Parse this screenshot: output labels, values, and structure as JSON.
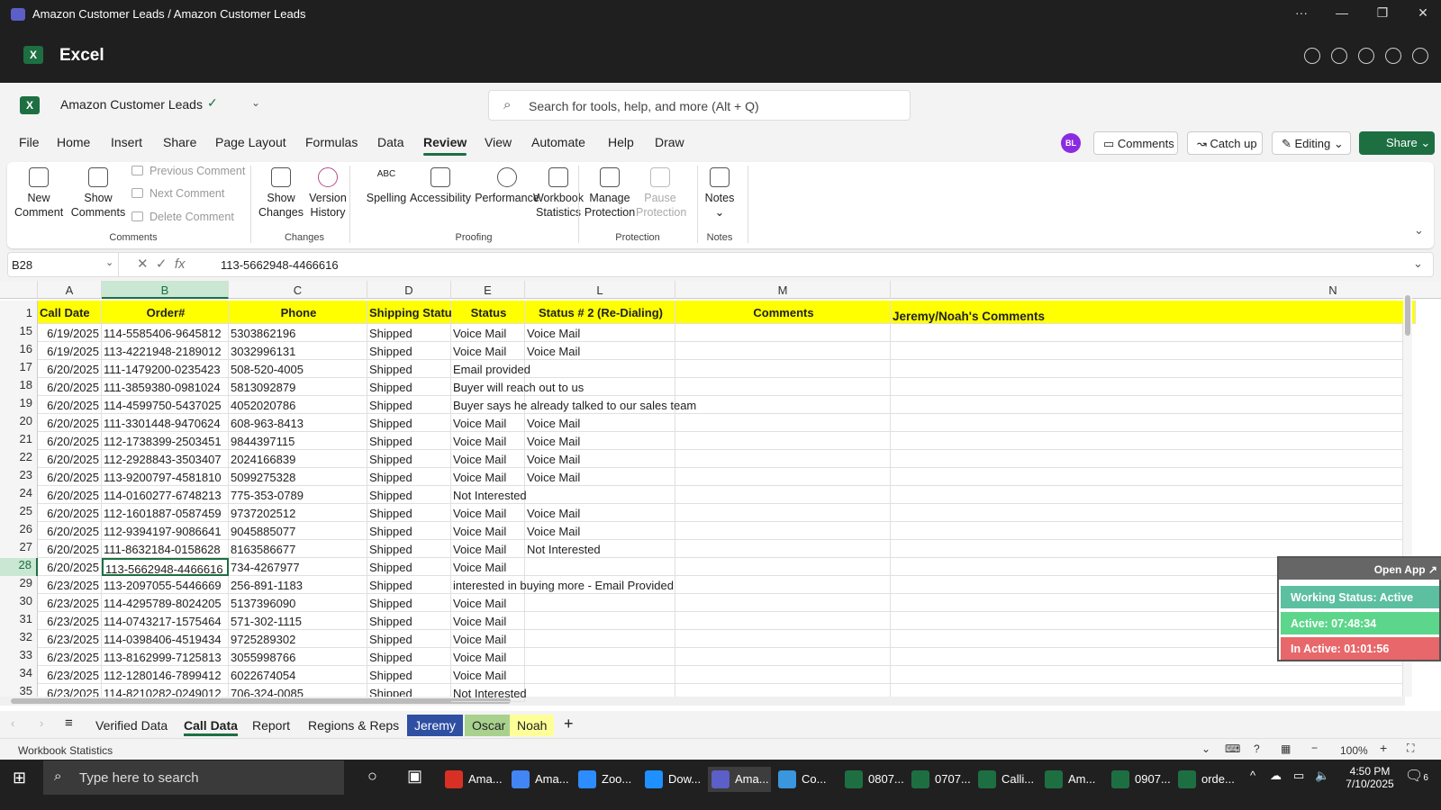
{
  "window": {
    "title": "Amazon Customer Leads / Amazon Customer Leads"
  },
  "app": {
    "name": "Excel"
  },
  "doc": {
    "name": "Amazon Customer Leads"
  },
  "search": {
    "placeholder": "Search for tools, help, and more (Alt + Q)"
  },
  "tabs": [
    "File",
    "Home",
    "Insert",
    "Share",
    "Page Layout",
    "Formulas",
    "Data",
    "Review",
    "View",
    "Automate",
    "Help",
    "Draw"
  ],
  "active_tab": "Review",
  "header": {
    "avatar": "BL",
    "comments": "Comments",
    "catchup": "Catch up",
    "editing": "Editing",
    "share": "Share"
  },
  "ribbon": {
    "new_comment": "New Comment",
    "show_comments": "Show Comments",
    "previous_comment": "Previous Comment",
    "next_comment": "Next Comment",
    "delete_comment": "Delete Comment",
    "group_comments": "Comments",
    "show_changes": "Show Changes",
    "version_history": "Version History",
    "group_changes": "Changes",
    "spelling": "Spelling",
    "accessibility": "Accessibility",
    "performance": "Performance",
    "workbook_statistics": "Workbook Statistics",
    "group_proofing": "Proofing",
    "manage_protection": "Manage Protection",
    "pause_protection": "Pause Protection",
    "group_protection": "Protection",
    "notes": "Notes",
    "group_notes": "Notes"
  },
  "formula": {
    "namebox": "B28",
    "fx": "fx",
    "value": "113-5662948-4466616"
  },
  "columns": [
    "A",
    "B",
    "C",
    "D",
    "E",
    "L",
    "M",
    "N"
  ],
  "header_row": {
    "num": "1",
    "a": "Call Date",
    "b": "Order#",
    "c": "Phone",
    "d": "Shipping Status",
    "e": "Status",
    "l": "Status # 2 (Re-Dialing)",
    "m": "Comments",
    "n": "Jeremy/Noah's Comments"
  },
  "rows": [
    {
      "num": "15",
      "a": "6/19/2025",
      "b": "114-5585406-9645812",
      "c": "5303862196",
      "d": "Shipped",
      "e": "Voice Mail",
      "l": "Voice Mail"
    },
    {
      "num": "16",
      "a": "6/19/2025",
      "b": "113-4221948-2189012",
      "c": "3032996131",
      "d": "Shipped",
      "e": "Voice Mail",
      "l": "Voice Mail"
    },
    {
      "num": "17",
      "a": "6/20/2025",
      "b": "111-1479200-0235423",
      "c": "508-520-4005",
      "d": "Shipped",
      "e": "Email provided",
      "l": ""
    },
    {
      "num": "18",
      "a": "6/20/2025",
      "b": "111-3859380-0981024",
      "c": "5813092879",
      "d": "Shipped",
      "e": "Buyer will reach out to us",
      "l": ""
    },
    {
      "num": "19",
      "a": "6/20/2025",
      "b": "114-4599750-5437025",
      "c": "4052020786",
      "d": "Shipped",
      "e": "Buyer says he already talked to our sales team",
      "l": ""
    },
    {
      "num": "20",
      "a": "6/20/2025",
      "b": "111-3301448-9470624",
      "c": "608-963-8413",
      "d": "Shipped",
      "e": "Voice Mail",
      "l": "Voice Mail"
    },
    {
      "num": "21",
      "a": "6/20/2025",
      "b": "112-1738399-2503451",
      "c": "9844397115",
      "d": "Shipped",
      "e": "Voice Mail",
      "l": "Voice Mail"
    },
    {
      "num": "22",
      "a": "6/20/2025",
      "b": "112-2928843-3503407",
      "c": "2024166839",
      "d": "Shipped",
      "e": "Voice Mail",
      "l": "Voice Mail"
    },
    {
      "num": "23",
      "a": "6/20/2025",
      "b": "113-9200797-4581810",
      "c": "5099275328",
      "d": "Shipped",
      "e": "Voice Mail",
      "l": "Voice Mail"
    },
    {
      "num": "24",
      "a": "6/20/2025",
      "b": "114-0160277-6748213",
      "c": "775-353-0789",
      "d": "Shipped",
      "e": "Not Interested",
      "l": ""
    },
    {
      "num": "25",
      "a": "6/20/2025",
      "b": "112-1601887-0587459",
      "c": "9737202512",
      "d": "Shipped",
      "e": "Voice Mail",
      "l": "Voice Mail"
    },
    {
      "num": "26",
      "a": "6/20/2025",
      "b": "112-9394197-9086641",
      "c": "9045885077",
      "d": "Shipped",
      "e": "Voice Mail",
      "l": "Voice Mail"
    },
    {
      "num": "27",
      "a": "6/20/2025",
      "b": "111-8632184-0158628",
      "c": "8163586677",
      "d": "Shipped",
      "e": "Voice Mail",
      "l": "Not Interested"
    },
    {
      "num": "28",
      "a": "6/20/2025",
      "b": "113-5662948-4466616",
      "c": "734-4267977",
      "d": "Shipped",
      "e": "Voice Mail",
      "l": ""
    },
    {
      "num": "29",
      "a": "6/23/2025",
      "b": "113-2097055-5446669",
      "c": "256-891-1183",
      "d": "Shipped",
      "e": "interested in buying more - Email Provided",
      "l": ""
    },
    {
      "num": "30",
      "a": "6/23/2025",
      "b": "114-4295789-8024205",
      "c": "5137396090",
      "d": "Shipped",
      "e": "Voice Mail",
      "l": ""
    },
    {
      "num": "31",
      "a": "6/23/2025",
      "b": "114-0743217-1575464",
      "c": "571-302-1115",
      "d": "Shipped",
      "e": "Voice Mail",
      "l": ""
    },
    {
      "num": "32",
      "a": "6/23/2025",
      "b": "114-0398406-4519434",
      "c": "9725289302",
      "d": "Shipped",
      "e": "Voice Mail",
      "l": ""
    },
    {
      "num": "33",
      "a": "6/23/2025",
      "b": "113-8162999-7125813",
      "c": "3055998766",
      "d": "Shipped",
      "e": "Voice Mail",
      "l": ""
    },
    {
      "num": "34",
      "a": "6/23/2025",
      "b": "112-1280146-7899412",
      "c": "6022674054",
      "d": "Shipped",
      "e": "Voice Mail",
      "l": ""
    },
    {
      "num": "35",
      "a": "6/23/2025",
      "b": "114-8210282-0249012",
      "c": "706-324-0085",
      "d": "Shipped",
      "e": "Not Interested",
      "l": ""
    }
  ],
  "widget": {
    "open_app": "Open App ↗",
    "working": "Working Status: Active",
    "active": "Active: 07:48:34",
    "inactive": "In Active: 01:01:56",
    "colors": {
      "working": "#5cbfa0",
      "active": "#5cd68a",
      "inactive": "#e8676a"
    }
  },
  "sheets": [
    {
      "name": "Verified Data",
      "color": ""
    },
    {
      "name": "Call Data",
      "color": "",
      "active": true
    },
    {
      "name": "Report",
      "color": ""
    },
    {
      "name": "Regions & Reps",
      "color": ""
    },
    {
      "name": "Jeremy",
      "color": "#2f4fa2"
    },
    {
      "name": "Oscar",
      "color": "#a9d18e"
    },
    {
      "name": "Noah",
      "color": "#ffff99"
    }
  ],
  "status": {
    "left": "Workbook Statistics",
    "zoom": "100%"
  },
  "taskbar": {
    "search": "Type here to search",
    "time": "4:50 PM",
    "date": "7/10/2025",
    "notif": "6",
    "apps": [
      "Ama...",
      "Ama...",
      "Zoo...",
      "Dow...",
      "Ama...",
      "Co...",
      "0807...",
      "0707...",
      "Calli...",
      "Am...",
      "0907...",
      "orde..."
    ]
  }
}
